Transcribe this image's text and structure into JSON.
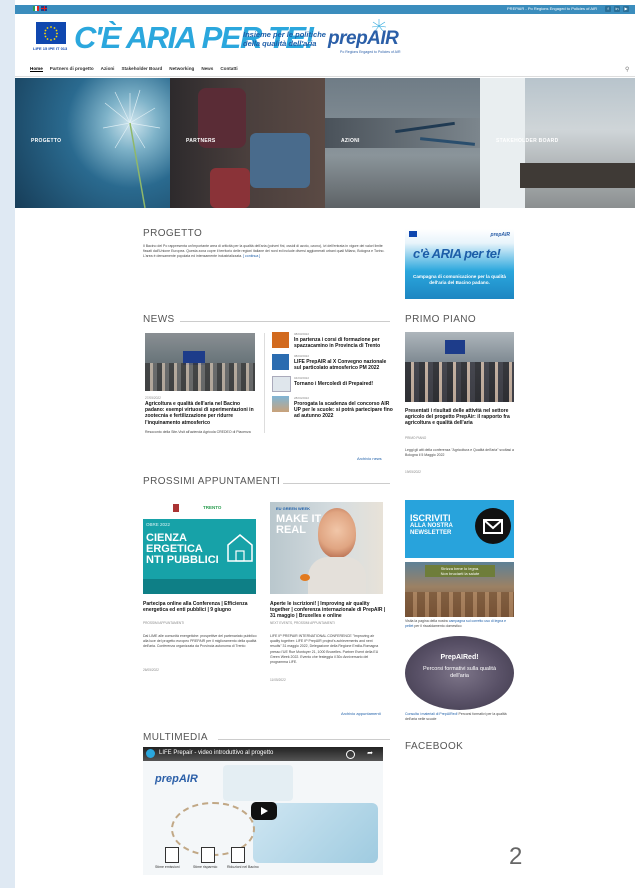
{
  "topbar": {
    "right_text": "PREPAIR - Po Regions Engaged to Policies of AIR",
    "social": [
      "f",
      "in",
      "▶"
    ],
    "colors": {
      "bar": "#3b8dbd"
    }
  },
  "header": {
    "eu_caption": "LIFE 15 IPE IT 013",
    "slogan": "C'È ARIA PER TE!",
    "slogan_sub_1": "Insieme per le politiche",
    "slogan_sub_2": "della qualità dell'aria",
    "brand": "prepAIR",
    "brand_sub": "Po Regions Engaged to Policies of AIR"
  },
  "nav": {
    "items": [
      "Home",
      "Partners di progetto",
      "Azioni",
      "Stakeholder Board",
      "Networking",
      "News",
      "Contatti"
    ],
    "active": "Home",
    "search_icon": "search-icon"
  },
  "hero": {
    "panels": [
      "PROGETTO",
      "PARTNERS",
      "AZIONI",
      "STAKEHOLDER BOARD"
    ]
  },
  "progetto": {
    "title": "PROGETTO",
    "text": "Il Bacino del Po rappresenta un'importante area di criticità per la qualità dell'aria (polveri fini, ossidi di azoto, ozono), ivi dell'entrata in vigore dei valori limite fissati dall'Unione Europea. Questa zona copre il territorio delle regioni italiane dei nord ed include diversi agglomerati urbani quali Milano, Bologna e Torino. L'area è densamente popolata ed intensamente industrializzata.",
    "more": "[ continua ]"
  },
  "campaign": {
    "line1": "c'è ARIA per te!",
    "line2": "Campagna di comunicazione per la qualità dell'aria del Bacino padano."
  },
  "news": {
    "title": "NEWS",
    "main_date": "27/05/2022",
    "main_title": "Agricoltura e qualità dell'aria nel Bacino padano: esempi virtuosi di sperimentazioni in zootecnia e fertilizzazione per ridurre l'inquinamento atmosferico",
    "main_text": "Resoconto della Site-Visit all'azienda Agricola CREDEO di Piacenza",
    "items": [
      {
        "date": "08/03/2022",
        "title": "In partenza i corsi di formazione per spazzacamino in Provincia di Trento"
      },
      {
        "date": "08/03/2022",
        "title": "LIFE PrepAIR al X Convegno nazionale sul particolato atmosferico PM 2022"
      },
      {
        "date": "04/03/2022",
        "title": "Tornano i Mercoledì di Prepaired!"
      },
      {
        "date": "28/04/2022",
        "title": "Prorogata la scadenza del concorso AIR UP per le scuole: si potrà partecipare fino ad autunno 2022"
      }
    ],
    "archive": "Archivio news"
  },
  "primo_piano": {
    "title": "PRIMO PIANO",
    "item_title": "Presentati i risultati delle attività nel settore agricolo del progetto PrepAir: il rapporto fra agricoltura e qualità dell'aria",
    "item_tag": "PRIMO PIANO",
    "text": "Leggi gli atti della conferenza \"Agricoltura e Qualità dell'aria\" svoltasi a Bologna il 5 Maggio 2022",
    "date": "19/05/2022"
  },
  "appuntamenti": {
    "title": "PROSSIMI APPUNTAMENTI",
    "left_img": {
      "top": "OBRE 2022",
      "top2": "TRENTO",
      "lines": [
        "CIENZA",
        "ERGETICA",
        "NTI PUBBLICI"
      ]
    },
    "left_title": "Partecipa online alla Conferenza | Efficienza energetica ed enti pubblici | 9 giugno",
    "left_tag": "PROSSIMI APPUNTAMENTI",
    "left_text": "Dal LIME alle comunità energetiche: prospettive del partenariato pubblico alla luce del progetto europeo PREPAIR per il miglioramento della qualità dell'aria. Conferenza organizzata da Provincia autonoma di Trento",
    "left_date": "26/05/2022",
    "right_img": {
      "top": "EU GREEN WEEK",
      "lines": [
        "MAKE IT",
        "REAL"
      ]
    },
    "right_title": "Aperte le iscrizioni! | Improving air quality together | conferenza internazionale di PrepAIR | 31 maggio | Bruxelles e online",
    "right_tag": "NEXT EVENTS, PROSSIMI APPUNTAMENTI",
    "right_text": "LIFE IP PREPAIR INTERNATIONAL CONFERENCE \"Improving air quality together: LIFE IP PrepAIR project's achievements and next results\" 31 maggio 2022, Delegazione della Regione Emilia-Romagna presso l'UE Rue Montoyer 21, 1000 Bruxelles. Partner Event della EU Green Week 2022. Evento che festeggia il 30o Anniversario del programma LIFE.",
    "right_date": "11/05/2022",
    "archive": "Archivio appuntamenti"
  },
  "newsletter": {
    "line1": "ISCRIVITI",
    "line2": "ALLA NOSTRA",
    "line3": "NEWSLETTER"
  },
  "side": {
    "book_text_1": "Strizza bene lo legna.",
    "book_text_2": "Non bruciarti la salute",
    "visit_text_pre": "Visita la pagina della nostra ",
    "visit_link": "campagna sul corretto uso di legna e pellet",
    "visit_text_post": " per il riscaldamento domestico",
    "prepaired_title": "PrepAIRed!",
    "prepaired_sub": "Percorsi formativi sulla qualità dell'aria",
    "consulta_link": "Consulta i materiali di PrepAIRed!",
    "consulta_text": " Percorsi formativi per la qualità dell'aria nelle scuole",
    "facebook": "FACEBOOK"
  },
  "multimedia": {
    "title": "MULTIMEDIA",
    "video_title": "LIFE Prepair - video introduttivo al progetto",
    "brand": "prepAIR",
    "labels": [
      "Stime emissioni",
      "Stime risparmio",
      "Riduzioni nel Bacino"
    ]
  },
  "page_number": "2"
}
